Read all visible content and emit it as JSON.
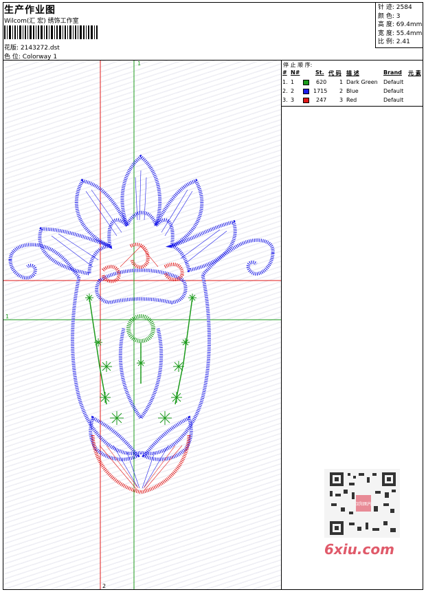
{
  "header": {
    "title": "生产作业图",
    "company": "Wilcom(汇 宏) 绣饰工作室",
    "design_file_label": "花版:",
    "design_file": "2143272.dst",
    "colorway_label": "色 位:",
    "colorway": "Colorway 1"
  },
  "stats": [
    {
      "label": "针 迹:",
      "value": "2584"
    },
    {
      "label": "颜 色:",
      "value": "3"
    },
    {
      "label": "高 度:",
      "value": "69.4mm"
    },
    {
      "label": "宽 度:",
      "value": "55.4mm"
    },
    {
      "label": "比 例:",
      "value": "2.41"
    }
  ],
  "stop_sequence": {
    "title": "停 止 顺 序:",
    "headers": [
      "#",
      "N#",
      "St.",
      "代 码",
      "描 述",
      "Brand",
      "元 素"
    ],
    "rows": [
      {
        "idx": "1.",
        "n": "1",
        "stitches": "620",
        "code": "1",
        "desc": "Dark Green",
        "brand": "Default",
        "color": "#1a9a1a"
      },
      {
        "idx": "2.",
        "n": "2",
        "stitches": "1715",
        "code": "2",
        "desc": "Blue",
        "brand": "Default",
        "color": "#1c1ce8"
      },
      {
        "idx": "3.",
        "n": "3",
        "stitches": "247",
        "code": "3",
        "desc": "Red",
        "brand": "Default",
        "color": "#e01818"
      }
    ]
  },
  "guides": {
    "green_label": "1",
    "red_label": "2"
  },
  "watermark": "6xiu.com",
  "qr_label": "汉阳图片"
}
